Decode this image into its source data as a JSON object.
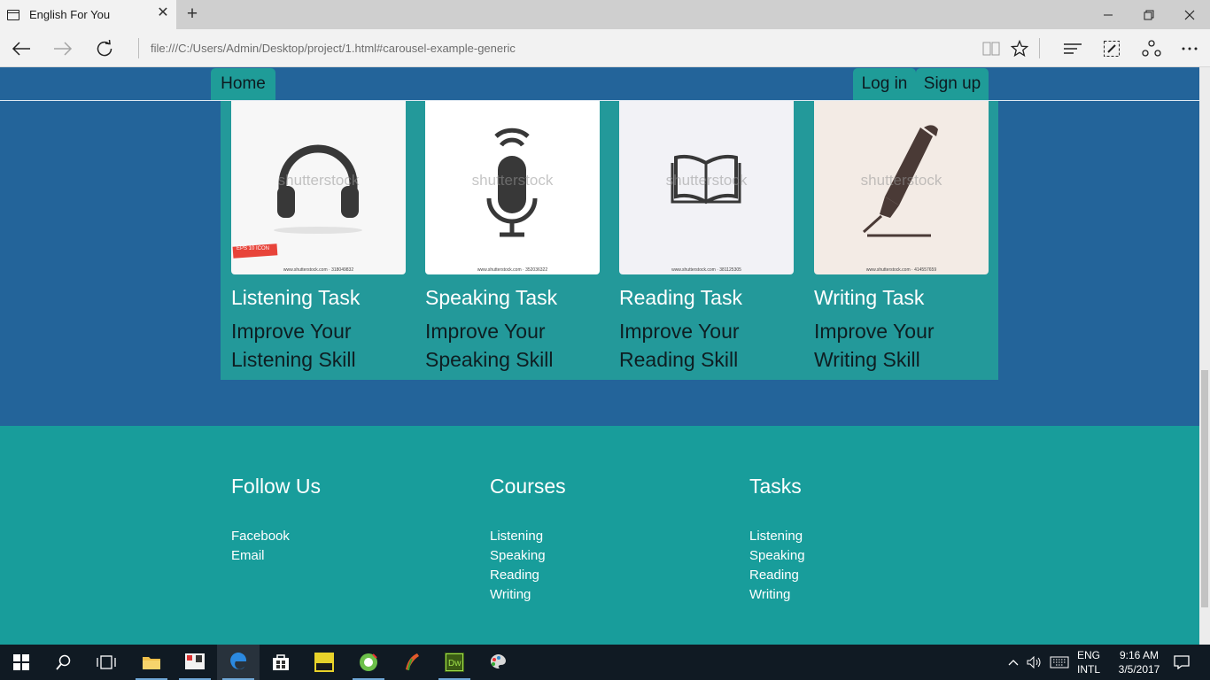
{
  "browser": {
    "tab_title": "English For You",
    "url": "file:///C:/Users/Admin/Desktop/project/1.html#carousel-example-generic"
  },
  "nav": {
    "home": "Home",
    "login": "Log in",
    "signup": "Sign up"
  },
  "cards": [
    {
      "icon": "headphones-icon",
      "watermark": "shutterstock",
      "stock_id": "www.shutterstock.com · 318049832",
      "badge": "EPS 10 ICON",
      "title": "Listening Task",
      "desc_line1": "Improve Your",
      "desc_line2": "Listening Skill",
      "bg": "#f7f7f7"
    },
    {
      "icon": "microphone-icon",
      "watermark": "shutterstock",
      "stock_id": "www.shutterstock.com · 352036322",
      "title": "Speaking Task",
      "desc_line1": "Improve Your",
      "desc_line2": "Speaking Skill",
      "bg": "#ffffff"
    },
    {
      "icon": "book-icon",
      "watermark": "shutterstock",
      "stock_id": "www.shutterstock.com · 381125305",
      "title": "Reading Task",
      "desc_line1": "Improve Your",
      "desc_line2": "Reading Skill",
      "bg": "#f2f2f6"
    },
    {
      "icon": "pen-icon",
      "watermark": "shutterstock",
      "stock_id": "www.shutterstock.com · 414557659",
      "title": "Writing Task",
      "desc_line1": "Improve Your",
      "desc_line2": "Writing Skill",
      "bg": "#f3ebe5"
    }
  ],
  "footer": {
    "follow": {
      "heading": "Follow Us",
      "links": [
        "Facebook",
        "Email"
      ]
    },
    "courses": {
      "heading": "Courses",
      "links": [
        "Listening",
        "Speaking",
        "Reading",
        "Writing"
      ]
    },
    "tasks": {
      "heading": "Tasks",
      "links": [
        "Listening",
        "Speaking",
        "Reading",
        "Writing"
      ]
    }
  },
  "taskbar": {
    "lang_top": "ENG",
    "lang_bottom": "INTL",
    "time": "9:16 AM",
    "date": "3/5/2017"
  },
  "colors": {
    "page_bg": "#23649a",
    "panel_bg": "#23999a",
    "footer_bg": "#189d9b",
    "nav_button": "#1f9c98",
    "taskbar": "#101a23"
  }
}
